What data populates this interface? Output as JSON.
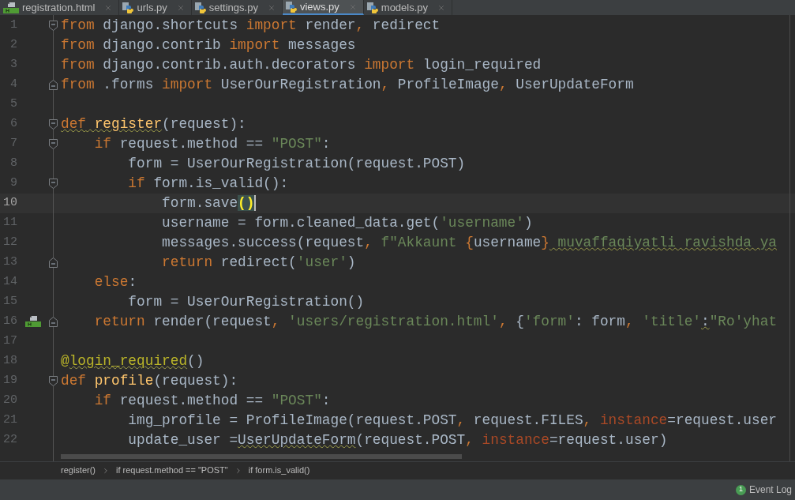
{
  "tabs": [
    {
      "label": "registration.html",
      "kind": "html",
      "selected": false
    },
    {
      "label": "urls.py",
      "kind": "python",
      "selected": false
    },
    {
      "label": "settings.py",
      "kind": "python",
      "selected": false
    },
    {
      "label": "views.py",
      "kind": "python",
      "selected": true
    },
    {
      "label": "models.py",
      "kind": "python",
      "selected": false
    }
  ],
  "lines": [
    {
      "number": "1",
      "current": false,
      "fold_start": true,
      "tokens": [
        {
          "kind": "kw",
          "text": "from"
        },
        {
          "kind": "plain",
          "text": " django.shortcuts "
        },
        {
          "kind": "kw",
          "text": "import"
        },
        {
          "kind": "plain",
          "text": " render"
        },
        {
          "kind": "kw",
          "text": ","
        },
        {
          "kind": "plain",
          "text": " redirect"
        }
      ]
    },
    {
      "number": "2",
      "current": false,
      "tokens": [
        {
          "kind": "kw",
          "text": "from"
        },
        {
          "kind": "plain",
          "text": " django.contrib "
        },
        {
          "kind": "kw",
          "text": "import"
        },
        {
          "kind": "plain",
          "text": " messages"
        }
      ]
    },
    {
      "number": "3",
      "current": false,
      "tokens": [
        {
          "kind": "kw",
          "text": "from"
        },
        {
          "kind": "plain",
          "text": " django.contrib.auth.decorators "
        },
        {
          "kind": "kw",
          "text": "import"
        },
        {
          "kind": "plain",
          "text": " login_required"
        }
      ]
    },
    {
      "number": "4",
      "current": false,
      "fold_end": true,
      "tokens": [
        {
          "kind": "kw",
          "text": "from"
        },
        {
          "kind": "plain",
          "text": " .forms "
        },
        {
          "kind": "kw",
          "text": "import"
        },
        {
          "kind": "plain",
          "text": " UserOurRegistration"
        },
        {
          "kind": "kw",
          "text": ","
        },
        {
          "kind": "plain",
          "text": " ProfileImage"
        },
        {
          "kind": "kw",
          "text": ","
        },
        {
          "kind": "plain",
          "text": " UserUpdateForm"
        }
      ]
    },
    {
      "number": "5",
      "current": false
    },
    {
      "number": "6",
      "current": false,
      "fold_start": true,
      "tokens": [
        {
          "kind": "kw",
          "text": "def",
          "warn": true
        },
        {
          "kind": "fn",
          "text": " register",
          "warn": true
        },
        {
          "kind": "plain",
          "text": "(request):"
        }
      ]
    },
    {
      "number": "7",
      "current": false,
      "fold_start": true,
      "tokens": [
        {
          "kind": "kw",
          "text": "    if"
        },
        {
          "kind": "plain",
          "text": " request.method == "
        },
        {
          "kind": "str",
          "text": "\"POST\""
        },
        {
          "kind": "plain",
          "text": ":"
        }
      ]
    },
    {
      "number": "8",
      "current": false,
      "tokens": [
        {
          "kind": "plain",
          "text": "        form = UserOurRegistration(request.POST)"
        }
      ]
    },
    {
      "number": "9",
      "current": false,
      "fold_start": true,
      "tokens": [
        {
          "kind": "kw",
          "text": "        if"
        },
        {
          "kind": "plain",
          "text": " form.is_valid():"
        }
      ]
    },
    {
      "number": "10",
      "current": true,
      "tokens": [
        {
          "kind": "plain",
          "text": "            form.save"
        },
        {
          "kind": "brace",
          "text": "()",
          "cursor_after": true
        }
      ]
    },
    {
      "number": "11",
      "current": false,
      "tokens": [
        {
          "kind": "plain",
          "text": "            username = form.cleaned_data.get("
        },
        {
          "kind": "str",
          "text": "'username'"
        },
        {
          "kind": "plain",
          "text": ")"
        }
      ]
    },
    {
      "number": "12",
      "current": false,
      "tokens": [
        {
          "kind": "plain",
          "text": "            messages.success(request"
        },
        {
          "kind": "kw",
          "text": ","
        },
        {
          "kind": "str",
          "text": " f\"Akkaunt "
        },
        {
          "kind": "kw",
          "text": "{"
        },
        {
          "kind": "plain",
          "text": "username"
        },
        {
          "kind": "kw",
          "text": "}"
        },
        {
          "kind": "str",
          "text": " muvaffaqiyatli ravishda ya",
          "warn": true
        }
      ]
    },
    {
      "number": "13",
      "current": false,
      "fold_end": true,
      "tokens": [
        {
          "kind": "kw",
          "text": "            return"
        },
        {
          "kind": "plain",
          "text": " redirect("
        },
        {
          "kind": "str",
          "text": "'user'"
        },
        {
          "kind": "plain",
          "text": ")"
        }
      ]
    },
    {
      "number": "14",
      "current": false,
      "tokens": [
        {
          "kind": "kw",
          "text": "    else"
        },
        {
          "kind": "plain",
          "text": ":"
        }
      ]
    },
    {
      "number": "15",
      "current": false,
      "tokens": [
        {
          "kind": "plain",
          "text": "        form = UserOurRegistration()"
        }
      ]
    },
    {
      "number": "16",
      "current": false,
      "fold_end": true,
      "template_marker": true,
      "tokens": [
        {
          "kind": "kw",
          "text": "    return"
        },
        {
          "kind": "plain",
          "text": " render(request"
        },
        {
          "kind": "kw",
          "text": ","
        },
        {
          "kind": "str",
          "text": " 'users/registration.html'"
        },
        {
          "kind": "kw",
          "text": ","
        },
        {
          "kind": "plain",
          "text": " {"
        },
        {
          "kind": "str",
          "text": "'form'"
        },
        {
          "kind": "plain",
          "text": ": form"
        },
        {
          "kind": "kw",
          "text": ","
        },
        {
          "kind": "str",
          "text": " 'title'"
        },
        {
          "kind": "plain",
          "text": ":",
          "warn": true
        },
        {
          "kind": "str",
          "text": "\"Ro'yhat"
        }
      ]
    },
    {
      "number": "17",
      "current": false
    },
    {
      "number": "18",
      "current": false,
      "tokens": [
        {
          "kind": "deco",
          "text": "@"
        },
        {
          "kind": "deco",
          "text": "login_required",
          "warn": true
        },
        {
          "kind": "plain",
          "text": "()"
        }
      ]
    },
    {
      "number": "19",
      "current": false,
      "fold_start": true,
      "tokens": [
        {
          "kind": "kw",
          "text": "def"
        },
        {
          "kind": "fn",
          "text": " profile"
        },
        {
          "kind": "plain",
          "text": "(request):"
        }
      ]
    },
    {
      "number": "20",
      "current": false,
      "tokens": [
        {
          "kind": "kw",
          "text": "    if"
        },
        {
          "kind": "plain",
          "text": " request.method == "
        },
        {
          "kind": "str",
          "text": "\"POST\""
        },
        {
          "kind": "plain",
          "text": ":"
        }
      ]
    },
    {
      "number": "21",
      "current": false,
      "tokens": [
        {
          "kind": "plain",
          "text": "        img_profile = ProfileImage(request.POST"
        },
        {
          "kind": "kw",
          "text": ","
        },
        {
          "kind": "plain",
          "text": " request.FILES"
        },
        {
          "kind": "kw",
          "text": ","
        },
        {
          "kind": "arg",
          "text": " instance"
        },
        {
          "kind": "plain",
          "text": "=request.user"
        }
      ]
    },
    {
      "number": "22",
      "current": false,
      "tokens": [
        {
          "kind": "plain",
          "text": "        update_user ="
        },
        {
          "kind": "plain",
          "text": "UserUpdateForm",
          "warn": true
        },
        {
          "kind": "plain",
          "text": "(request.POST"
        },
        {
          "kind": "kw",
          "text": ","
        },
        {
          "kind": "arg",
          "text": " instance"
        },
        {
          "kind": "plain",
          "text": "=request.user)"
        }
      ]
    }
  ],
  "breadcrumbs": [
    "register()",
    "if request.method == \"POST\"",
    "if form.is_valid()"
  ],
  "status_bar": {
    "event_log": {
      "count": "1",
      "label": "Event Log"
    }
  }
}
